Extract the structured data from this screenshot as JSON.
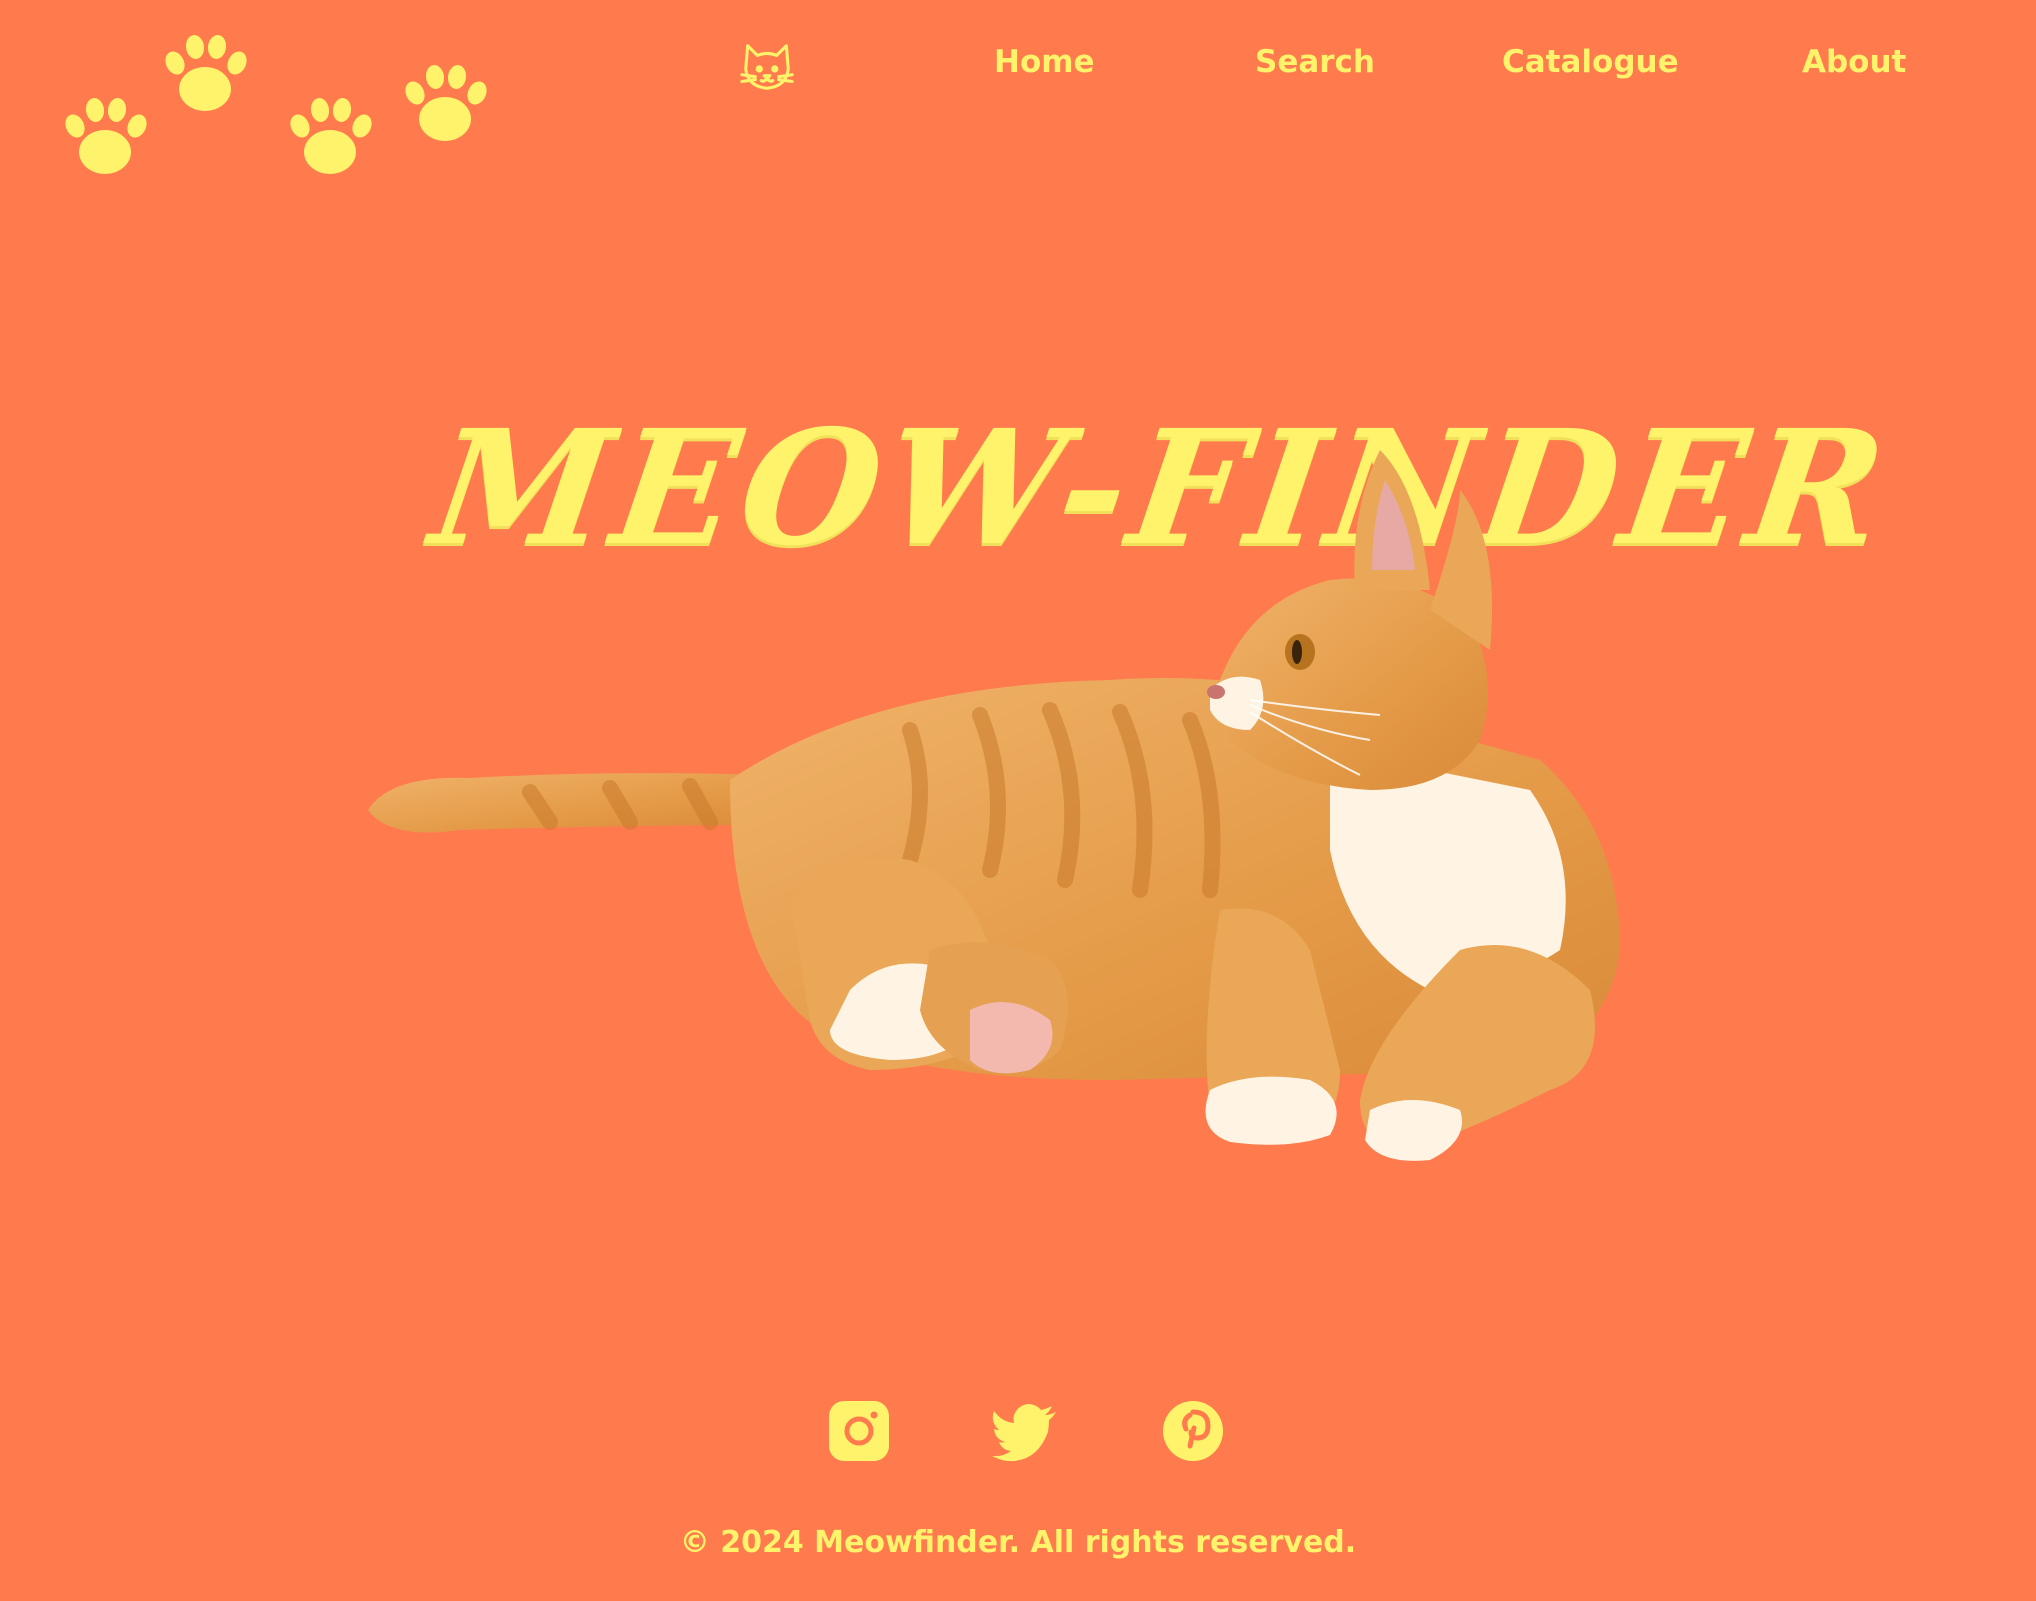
{
  "colors": {
    "background": "#FF7A4D",
    "accent": "#FFF36B",
    "cat_fur": "#E9A757",
    "cat_stripe": "#C97A2B",
    "cat_belly": "#FFF4E3"
  },
  "logo": {
    "icon": "paw-prints-icon"
  },
  "nav": {
    "cat_icon": "cat-face-icon",
    "items": [
      {
        "label": "Home"
      },
      {
        "label": "Search"
      },
      {
        "label": "Catalogue"
      },
      {
        "label": "About"
      }
    ]
  },
  "hero": {
    "title": "MEOW-FINDER",
    "image": "orange-tabby-cat"
  },
  "socials": {
    "items": [
      {
        "icon": "instagram-icon"
      },
      {
        "icon": "twitter-icon"
      },
      {
        "icon": "pinterest-icon"
      }
    ]
  },
  "footer": {
    "copyright": "© 2024 Meowfinder. All rights reserved."
  }
}
